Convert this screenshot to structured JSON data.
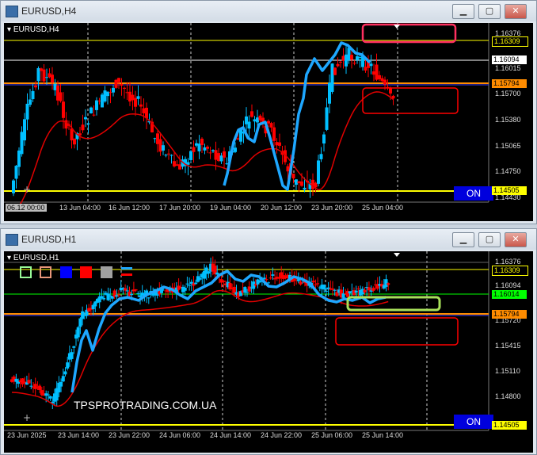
{
  "windows": [
    {
      "title": "EURUSD,H4",
      "symbol_label": "EURUSD,H4",
      "on_label": "ON",
      "price_scale": [
        "1.16376",
        "1.16015",
        "1.15700",
        "1.15380",
        "1.15065",
        "1.14750",
        "1.14430"
      ],
      "price_levels": [
        {
          "value": "1.16309",
          "color": "#ffff00"
        },
        {
          "value": "1.16094",
          "color": "#ffffff"
        },
        {
          "value": "1.15794",
          "color": "#ff8c00"
        },
        {
          "value": "1.14505",
          "color": "#ffff00"
        }
      ],
      "time_labels": [
        "06.12 00:00",
        "13 Jun 04:00",
        "16 Jun 12:00",
        "17 Jun 20:00",
        "19 Jun 04:00",
        "20 Jun 12:00",
        "23 Jun 20:00",
        "25 Jun 04:00"
      ]
    },
    {
      "title": "EURUSD,H1",
      "symbol_label": "EURUSD,H1",
      "on_label": "ON",
      "watermark": "TPSPROTRADING.COM.UA",
      "price_scale": [
        "1.16376",
        "1.16094",
        "1.15720",
        "1.15415",
        "1.15110",
        "1.14800"
      ],
      "price_levels": [
        {
          "value": "1.16309",
          "color": "#ffff00"
        },
        {
          "value": "1.16014",
          "color": "#00ff00"
        },
        {
          "value": "1.15794",
          "color": "#ff8c00"
        },
        {
          "value": "1.14505",
          "color": "#ffff00"
        }
      ],
      "time_labels": [
        "23 Jun 2025",
        "23 Jun 14:00",
        "23 Jun 22:00",
        "24 Jun 06:00",
        "24 Jun 14:00",
        "24 Jun 22:00",
        "25 Jun 06:00",
        "25 Jun 14:00"
      ],
      "swatch_colors": [
        "#98fb98",
        "#e9967a",
        "#0000ff",
        "#ff0000",
        "#a0a0a0"
      ]
    }
  ],
  "colors": {
    "bull": "#00bfff",
    "bear": "#ff0000",
    "ma": "#e00000",
    "trend": "#1ea7ff"
  }
}
